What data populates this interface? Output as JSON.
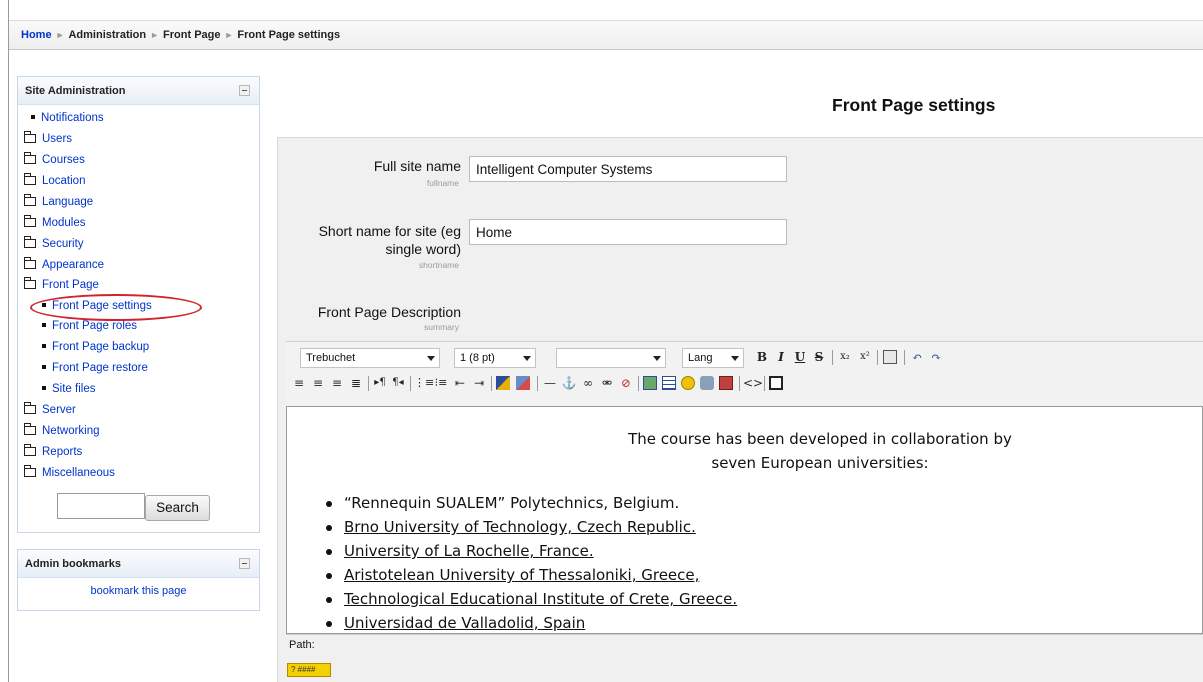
{
  "breadcrumb": [
    "Home",
    "Administration",
    "Front Page",
    "Front Page settings"
  ],
  "admin_block": {
    "title": "Site Administration",
    "items": [
      {
        "label": "Notifications",
        "kind": "leaf"
      },
      {
        "label": "Users",
        "kind": "folder"
      },
      {
        "label": "Courses",
        "kind": "folder"
      },
      {
        "label": "Location",
        "kind": "folder"
      },
      {
        "label": "Language",
        "kind": "folder"
      },
      {
        "label": "Modules",
        "kind": "folder"
      },
      {
        "label": "Security",
        "kind": "folder"
      },
      {
        "label": "Appearance",
        "kind": "folder"
      },
      {
        "label": "Front Page",
        "kind": "folder-open"
      },
      {
        "label": "Front Page settings",
        "kind": "sub"
      },
      {
        "label": "Front Page roles",
        "kind": "sub"
      },
      {
        "label": "Front Page backup",
        "kind": "sub"
      },
      {
        "label": "Front Page restore",
        "kind": "sub"
      },
      {
        "label": "Site files",
        "kind": "sub"
      },
      {
        "label": "Server",
        "kind": "folder"
      },
      {
        "label": "Networking",
        "kind": "folder"
      },
      {
        "label": "Reports",
        "kind": "folder"
      },
      {
        "label": "Miscellaneous",
        "kind": "folder"
      }
    ],
    "search_button": "Search",
    "search_value": ""
  },
  "bookmarks_block": {
    "title": "Admin bookmarks",
    "link": "bookmark this page"
  },
  "main": {
    "title": "Front Page settings",
    "fields": {
      "fullname": {
        "label": "Full site name",
        "sub": "fullname",
        "value": "Intelligent Computer Systems"
      },
      "shortname": {
        "label_line1": "Short name for site (eg",
        "label_line2": "single word)",
        "sub": "shortname",
        "value": "Home"
      },
      "summary": {
        "label": "Front Page Description",
        "sub": "summary"
      }
    },
    "editor": {
      "font": "Trebuchet",
      "size": "1 (8 pt)",
      "format": "",
      "lang": "Lang",
      "content": {
        "intro_line1": "The course has been developed in collaboration by",
        "intro_line2": "seven European universities:",
        "universities": [
          "“Rennequin SUALEM” Polytechnics, Belgium.",
          "Brno University of Technology, Czech Republic.",
          "University of La Rochelle, France.",
          "Aristotelean University of Thessaloniki, Greece,",
          "Technological Educational Institute of Crete, Greece.",
          "Universidad de Valladolid, Spain"
        ]
      },
      "path_label": "Path:"
    }
  },
  "colors": {
    "link": "#0033cc",
    "highlight_ring": "#d2232a",
    "help_button": "#f4d000"
  }
}
